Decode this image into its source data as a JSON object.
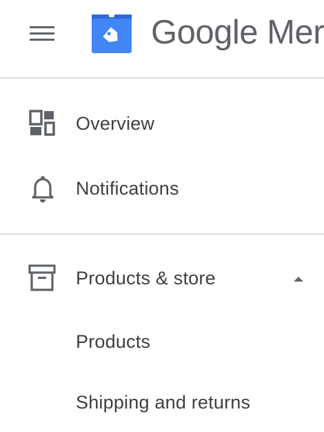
{
  "header": {
    "menu_icon": "hamburger-menu-icon",
    "logo_icon": "merchant-tag-logo-icon",
    "brand_text": "Google Merc",
    "brand_color": "#5f6368",
    "logo_color": "#4285f4"
  },
  "nav": {
    "overview": {
      "label": "Overview",
      "icon": "dashboard-icon"
    },
    "notifications": {
      "label": "Notifications",
      "icon": "bell-icon"
    },
    "products_store": {
      "label": "Products & store",
      "icon": "archive-box-icon",
      "expanded": true,
      "expand_icon": "caret-up-icon"
    },
    "products": {
      "label": "Products"
    },
    "shipping": {
      "label": "Shipping and returns"
    }
  },
  "colors": {
    "text": "#3c4043",
    "icon": "#5f6368",
    "divider": "#dadce0"
  }
}
